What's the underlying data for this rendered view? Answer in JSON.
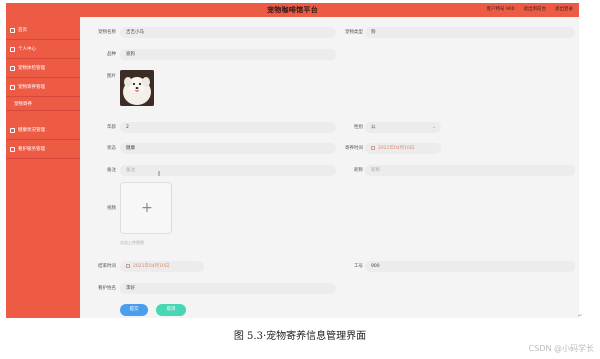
{
  "header": {
    "title": "宠物咖啡馆平台",
    "links": [
      "客户特号 900",
      "退出到前台",
      "退出登录"
    ]
  },
  "sidebar": {
    "items": [
      {
        "label": "首页"
      },
      {
        "label": "个人中心"
      },
      {
        "label": "宠物体检管理"
      },
      {
        "label": "宠物寄养管理"
      },
      {
        "label": "宠物寄养"
      },
      {
        "label": "健康状况管理"
      },
      {
        "label": "看护服务管理"
      }
    ]
  },
  "form": {
    "pet_name": {
      "label": "宠物名称",
      "value": "吉吉小马"
    },
    "pet_type": {
      "label": "宠物类型",
      "value": "狗"
    },
    "breed": {
      "label": "品种",
      "value": "竟狗"
    },
    "image": {
      "label": "图片"
    },
    "age": {
      "label": "年龄",
      "value": "2"
    },
    "gender": {
      "label": "性别",
      "value": "公"
    },
    "health": {
      "label": "状态",
      "value": "健康"
    },
    "board_time": {
      "label": "寄养时间",
      "value": "2021年04月10日"
    },
    "remark": {
      "label": "备注",
      "placeholder": "备注"
    },
    "nickname": {
      "label": "昵称",
      "placeholder": "昵称"
    },
    "video": {
      "label": "视频",
      "hint": "点击上传视频"
    },
    "end_time": {
      "label": "结束时间",
      "value": "2021年04月10日"
    },
    "staff_id": {
      "label": "工号",
      "value": "900"
    },
    "caretaker": {
      "label": "看护姓名",
      "value": "李好"
    }
  },
  "buttons": {
    "submit": "提交",
    "cancel": "取消"
  },
  "caption": "图 5.3·宠物寄养信息管理界面",
  "watermark": "CSDN @小码学长",
  "icons": {
    "sidebar": "menu-icon",
    "calendar": "calendar-icon",
    "upload": "plus-icon"
  },
  "colors": {
    "header": "#ee5b45",
    "submit": "#4a9ef0",
    "cancel": "#48d6b4"
  }
}
